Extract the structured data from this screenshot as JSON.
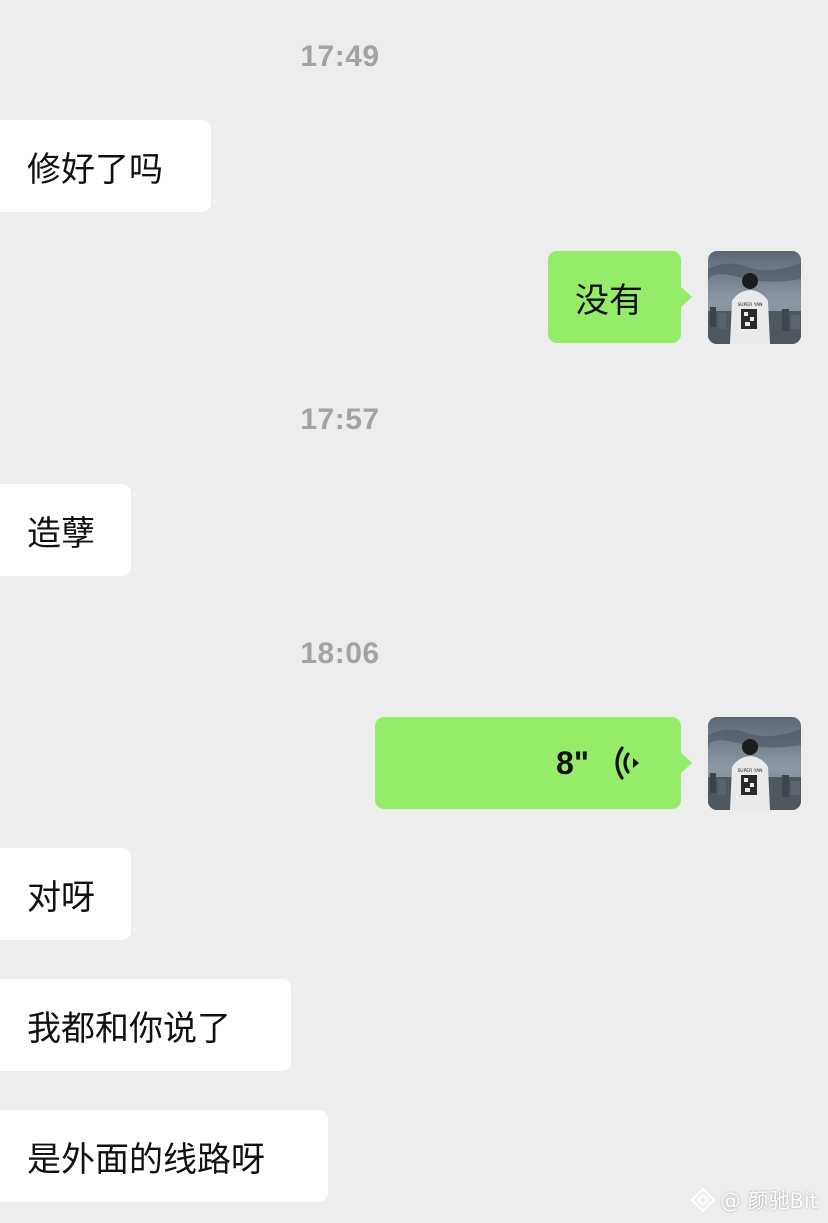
{
  "chat": {
    "timestamps": [
      "17:49",
      "17:57",
      "18:06"
    ],
    "messages": {
      "m1": "修好了吗",
      "m2": "没有",
      "m3": "造孽",
      "m4_voice_duration": "8\"",
      "m5": "对呀",
      "m6": "我都和你说了",
      "m7": "是外面的线路呀"
    },
    "avatar_shirt_text": "SUPER YAN"
  },
  "watermark": {
    "text": "@ 颜驰Bit"
  },
  "colors": {
    "background": "#ededed",
    "incoming_bubble": "#ffffff",
    "outgoing_bubble": "#95ec69",
    "timestamp": "#a3a3a3"
  }
}
